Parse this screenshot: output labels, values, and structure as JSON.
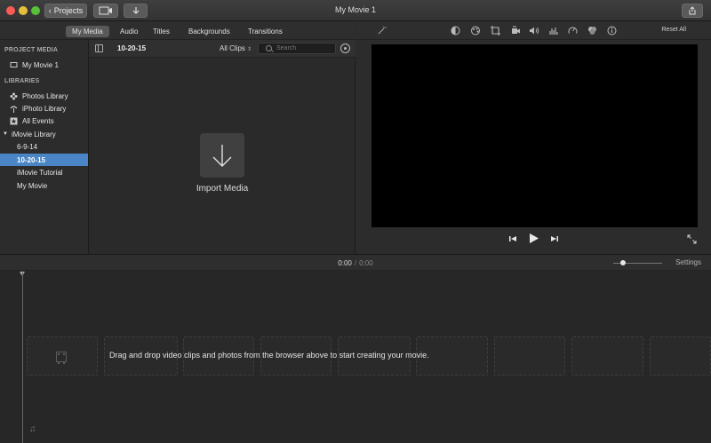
{
  "window": {
    "title": "My Movie 1"
  },
  "toolbar": {
    "projects_label": "Projects",
    "projects_icon": "chevron-left-icon",
    "media_icon": "media-browser-icon",
    "import_icon": "import-arrow-icon",
    "share_icon": "share-icon"
  },
  "tabs": [
    "My Media",
    "Audio",
    "Titles",
    "Backgrounds",
    "Transitions"
  ],
  "sidebar": {
    "project_media_header": "PROJECT MEDIA",
    "project_item": "My Movie 1",
    "libraries_header": "LIBRARIES",
    "library_items": [
      "Photos Library",
      "iPhoto Library",
      "All Events"
    ],
    "imovie_library": "iMovie Library",
    "events": [
      "6-9-14",
      "10-20-15",
      "iMovie Tutorial",
      "My Movie"
    ],
    "selected_event": "10-20-15"
  },
  "browser": {
    "event_title": "10-20-15",
    "clips_filter": "All Clips",
    "search_placeholder": "Search",
    "import_label": "Import Media"
  },
  "viewer": {
    "reset_all": "Reset All"
  },
  "timeline": {
    "current_time": "0:00",
    "separator": "/",
    "total_time": "0:00",
    "settings_label": "Settings",
    "drop_message": "Drag and drop video clips and photos from the browser above to start creating your movie."
  },
  "colors": {
    "selection": "#4a86c6",
    "close": "#fc5b57",
    "minimize": "#e5bf3c",
    "maximize": "#57c038"
  }
}
